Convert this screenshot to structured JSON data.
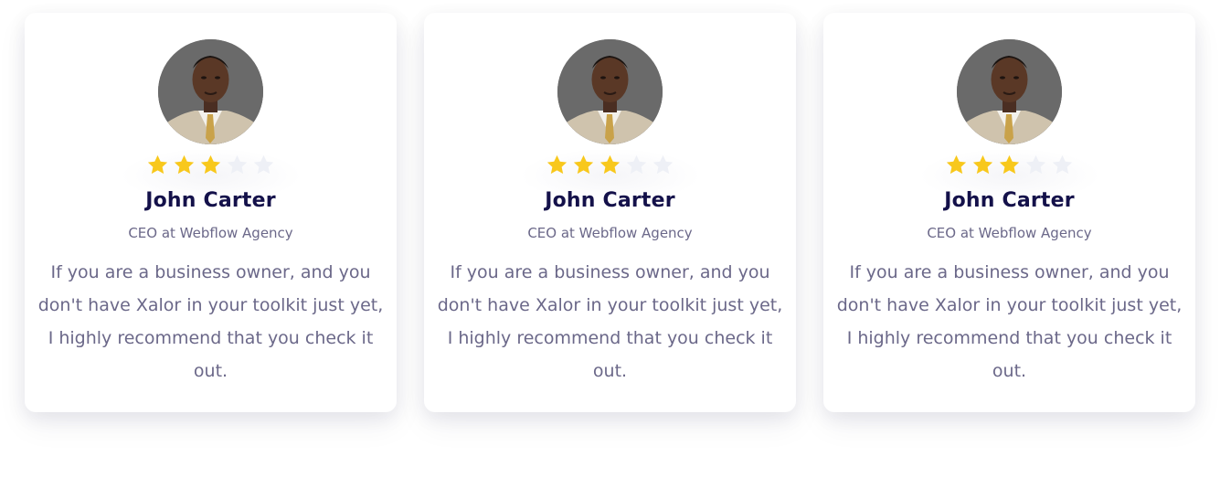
{
  "testimonials": [
    {
      "avatar_icon": "person-photo",
      "rating": 3,
      "rating_max": 5,
      "name": "John Carter",
      "role": "CEO at Webflow Agency",
      "quote": "If you are a business owner, and you don't have Xalor in your toolkit just yet, I highly recommend that you check it out."
    },
    {
      "avatar_icon": "person-photo",
      "rating": 3,
      "rating_max": 5,
      "name": "John Carter",
      "role": "CEO at Webflow Agency",
      "quote": "If you are a business owner, and you don't have Xalor in your toolkit just yet, I highly recommend that you check it out."
    },
    {
      "avatar_icon": "person-photo",
      "rating": 3,
      "rating_max": 5,
      "name": "John Carter",
      "role": "CEO at Webflow Agency",
      "quote": "If you are a business owner, and you don't have Xalor in your toolkit just yet, I highly recommend that you check it out."
    }
  ],
  "colors": {
    "star_filled": "#f8c81c",
    "star_empty": "#eef0f6",
    "name": "#14114a",
    "text_muted": "#6b6889"
  }
}
